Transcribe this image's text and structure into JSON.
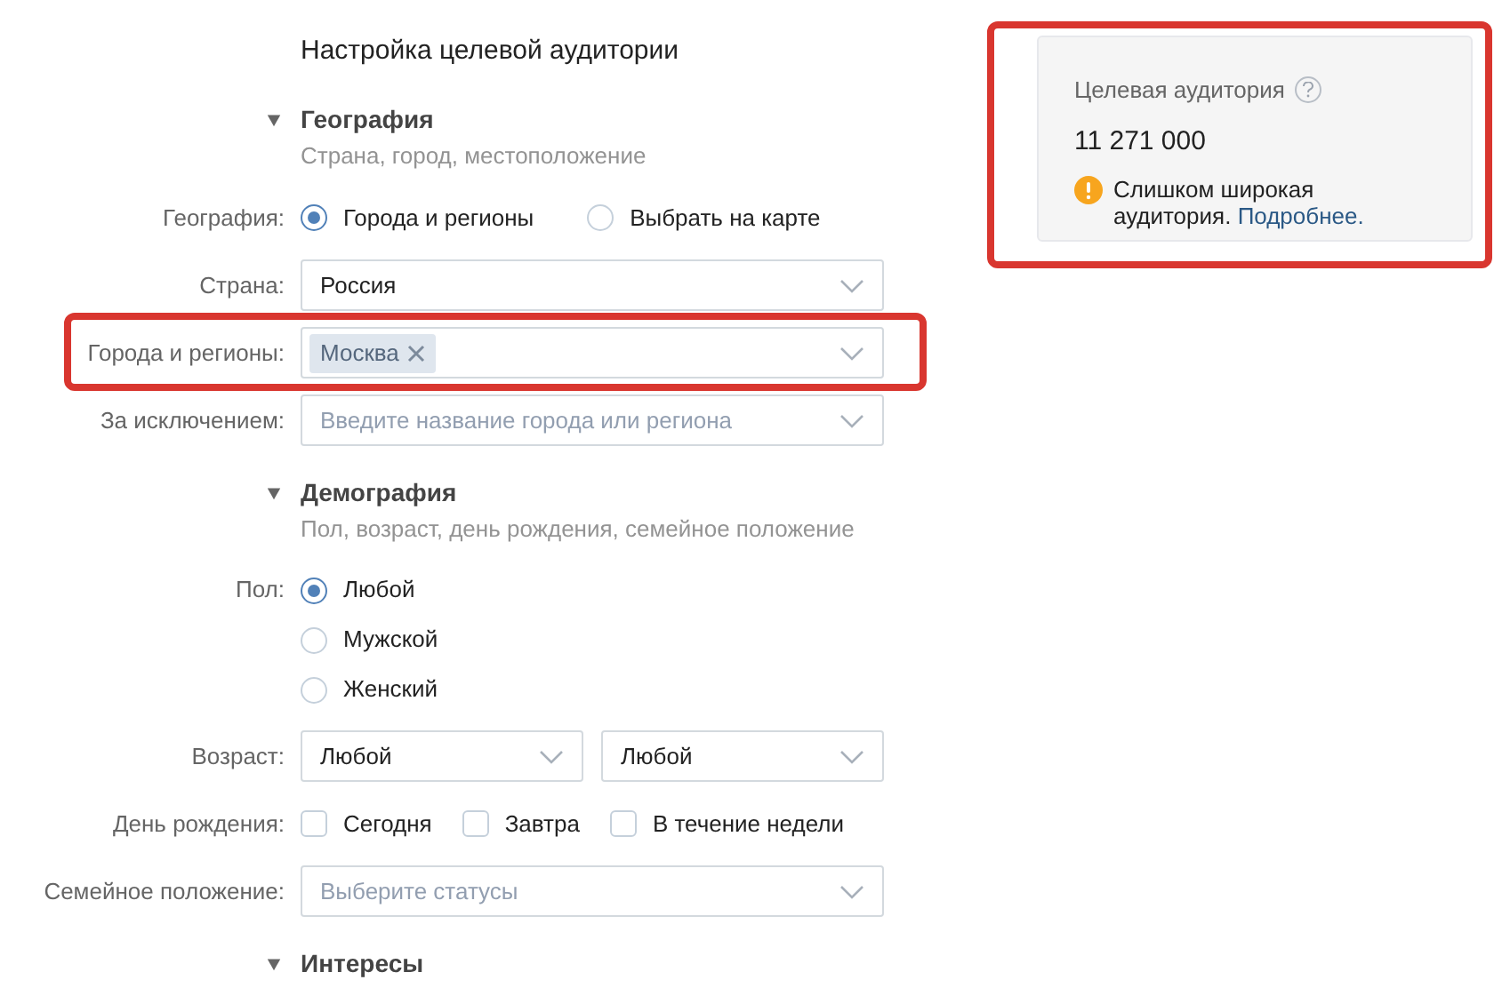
{
  "title": "Настройка целевой аудитории",
  "sections": [
    {
      "title": "География",
      "expanded": true,
      "subtitle": "Страна, город, местоположение",
      "rows": [
        {
          "kind": "radio_inline",
          "label": "География:",
          "options": [
            {
              "label": "Города и регионы",
              "selected": true
            },
            {
              "label": "Выбрать на карте",
              "selected": false
            }
          ]
        },
        {
          "kind": "select",
          "label": "Страна:",
          "value": "Россия"
        },
        {
          "kind": "tags",
          "label": "Города и регионы:",
          "highlighted": true,
          "tags": [
            "Москва"
          ]
        },
        {
          "kind": "select",
          "label": "За исключением:",
          "placeholder": "Введите название города или региона"
        }
      ]
    },
    {
      "title": "Демография",
      "expanded": true,
      "subtitle": "Пол, возраст, день рождения, семейное положение",
      "rows": [
        {
          "kind": "radio_stacked",
          "label": "Пол:",
          "options": [
            {
              "label": "Любой",
              "selected": true
            },
            {
              "label": "Мужской",
              "selected": false
            },
            {
              "label": "Женский",
              "selected": false
            }
          ]
        },
        {
          "kind": "select_pair",
          "label": "Возраст:",
          "values": [
            "Любой",
            "Любой"
          ]
        },
        {
          "kind": "checkboxes",
          "label": "День рождения:",
          "options": [
            {
              "label": "Сегодня",
              "checked": false
            },
            {
              "label": "Завтра",
              "checked": false
            },
            {
              "label": "В течение недели",
              "checked": false
            }
          ]
        },
        {
          "kind": "select",
          "label": "Семейное положение:",
          "placeholder": "Выберите статусы"
        }
      ]
    },
    {
      "title": "Интересы",
      "expanded": true
    }
  ],
  "audience": {
    "title": "Целевая аудитория",
    "count": "11 271 000",
    "warning": "Слишком широкая аудитория.",
    "link": "Подробнее.",
    "highlighted": true
  }
}
